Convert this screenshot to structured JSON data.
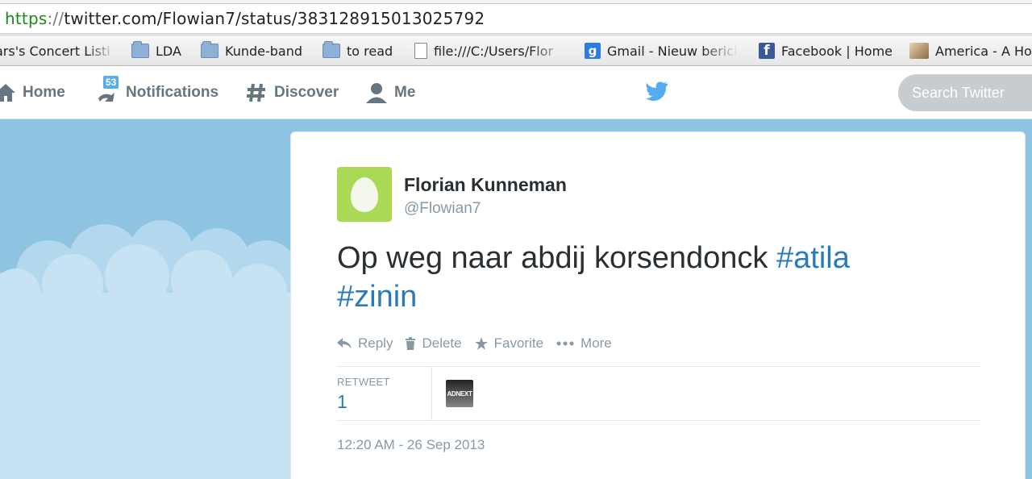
{
  "browser": {
    "url_scheme": "https",
    "url_sep": "://",
    "url_rest": "twitter.com/Flowian7/status/383128915013025792",
    "bookmarks": [
      {
        "label": "ars's Concert Listi",
        "icon": "file-icon"
      },
      {
        "label": "LDA",
        "icon": "folder-icon"
      },
      {
        "label": "Kunde-band",
        "icon": "folder-icon"
      },
      {
        "label": "to read",
        "icon": "folder-icon"
      },
      {
        "label": "file:///C:/Users/Flor",
        "icon": "file-icon"
      },
      {
        "label": "Gmail - Nieuw bericl",
        "icon": "gmail-icon"
      },
      {
        "label": "Facebook | Home",
        "icon": "facebook-icon"
      },
      {
        "label": "America - A Ho",
        "icon": "image-icon"
      }
    ]
  },
  "nav": {
    "home": "Home",
    "notifications": "Notifications",
    "notifications_badge": "53",
    "discover": "Discover",
    "me": "Me",
    "search_placeholder": "Search Twitter"
  },
  "tweet": {
    "author_name": "Florian Kunneman",
    "author_handle": "@Flowian7",
    "text_plain": "Op weg naar abdij korsendonck ",
    "hashtag_1": "#atila",
    "hashtag_2": "#zinin",
    "actions": {
      "reply": "Reply",
      "delete": "Delete",
      "favorite": "Favorite",
      "more": "More"
    },
    "retweet_label": "RETWEET",
    "retweet_count": "1",
    "retweeter_avatar_text": "ADNEXT",
    "timestamp": "12:20 AM - 26 Sep 2013"
  },
  "colors": {
    "link": "#2b7bb9",
    "background_sky": "#8ec3e2",
    "muted": "#8899a6",
    "avatar_green": "#a9d955"
  }
}
